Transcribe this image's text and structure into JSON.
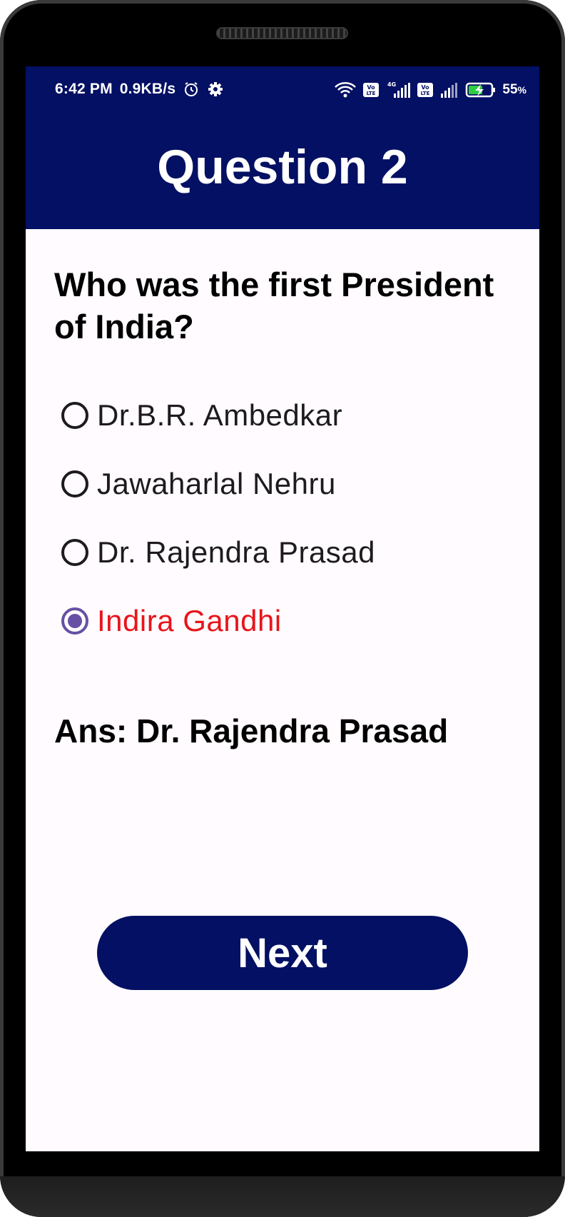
{
  "status_bar": {
    "time": "6:42 PM",
    "net_speed": "0.9KB/s",
    "battery": "55",
    "battery_unit": "%",
    "icons": [
      "alarm-icon",
      "settings-gear-icon",
      "wifi-icon",
      "volte-icon",
      "signal-4g-icon",
      "signal-icon",
      "battery-charging-icon"
    ]
  },
  "header": {
    "title": "Question 2",
    "background": "#031063"
  },
  "quiz": {
    "question": "Who was the first President of India?",
    "options": [
      {
        "label": "Dr.B.R. Ambedkar",
        "selected": false
      },
      {
        "label": "Jawaharlal Nehru",
        "selected": false
      },
      {
        "label": "Dr. Rajendra Prasad",
        "selected": false
      },
      {
        "label": "Indira Gandhi",
        "selected": true
      }
    ],
    "selected_color": "#e8141a",
    "answer": "Ans: Dr. Rajendra Prasad"
  },
  "actions": {
    "next_label": "Next"
  }
}
